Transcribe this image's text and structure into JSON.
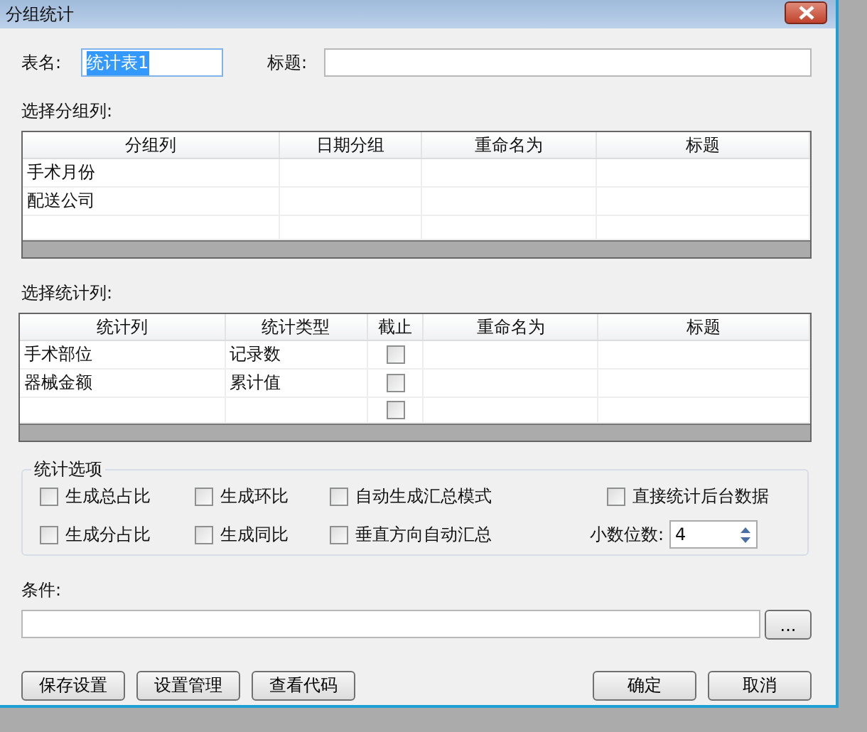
{
  "window": {
    "title": "分组统计"
  },
  "table_name": {
    "label": "表名:",
    "value": "统计表1",
    "selected": true
  },
  "title_field": {
    "label": "标题:"
  },
  "group_section": {
    "label": "选择分组列:",
    "columns": [
      "分组列",
      "日期分组",
      "重命名为",
      "标题"
    ],
    "rows": [
      {
        "group_column": "手术月份"
      },
      {
        "group_column": "配送公司"
      },
      {}
    ]
  },
  "stat_section": {
    "label": "选择统计列:",
    "columns": [
      "统计列",
      "统计类型",
      "截止",
      "重命名为",
      "标题"
    ],
    "rows": [
      {
        "stat_column": "手术部位",
        "stat_type": "记录数",
        "cutoff": false
      },
      {
        "stat_column": "器械金额",
        "stat_type": "累计值",
        "cutoff": false
      },
      {
        "cutoff": false
      }
    ]
  },
  "options": {
    "title": "统计选项",
    "checkboxes": [
      {
        "label": "生成总占比",
        "checked": false
      },
      {
        "label": "生成环比",
        "checked": false
      },
      {
        "label": "自动生成汇总模式",
        "checked": false
      },
      {
        "label": "直接统计后台数据",
        "checked": false
      },
      {
        "label": "生成分占比",
        "checked": false
      },
      {
        "label": "生成同比",
        "checked": false
      },
      {
        "label": "垂直方向自动汇总",
        "checked": false
      }
    ],
    "decimals": {
      "label": "小数位数:",
      "value": "4"
    }
  },
  "condition": {
    "label": "条件:",
    "browse": "..."
  },
  "buttons_left": [
    "保存设置",
    "设置管理",
    "查看代码"
  ],
  "buttons_right": [
    "确定",
    "取消"
  ]
}
